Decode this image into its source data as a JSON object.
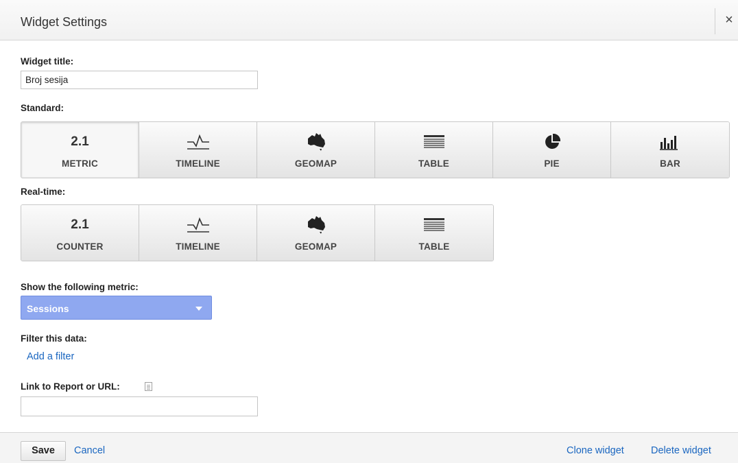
{
  "dialog": {
    "title": "Widget Settings",
    "close_symbol": "×"
  },
  "widget_title": {
    "label": "Widget title:",
    "value": "Broj sesija"
  },
  "standard": {
    "label": "Standard:",
    "options": [
      {
        "caption": "METRIC",
        "icon": "2.1",
        "icon_name": "metric-value",
        "selected": true
      },
      {
        "caption": "TIMELINE",
        "icon_name": "timeline-icon",
        "selected": false
      },
      {
        "caption": "GEOMAP",
        "icon_name": "australia-map-icon",
        "selected": false
      },
      {
        "caption": "TABLE",
        "icon_name": "table-icon",
        "selected": false
      },
      {
        "caption": "PIE",
        "icon_name": "pie-icon",
        "selected": false
      },
      {
        "caption": "BAR",
        "icon_name": "bar-chart-icon",
        "selected": false
      }
    ]
  },
  "realtime": {
    "label": "Real-time:",
    "options": [
      {
        "caption": "COUNTER",
        "icon": "2.1",
        "icon_name": "counter-value"
      },
      {
        "caption": "TIMELINE",
        "icon_name": "timeline-icon"
      },
      {
        "caption": "GEOMAP",
        "icon_name": "australia-map-icon"
      },
      {
        "caption": "TABLE",
        "icon_name": "table-icon"
      }
    ]
  },
  "metric": {
    "label": "Show the following metric:",
    "selected": "Sessions"
  },
  "filter": {
    "label": "Filter this data:",
    "add_link": "Add a filter"
  },
  "link": {
    "label": "Link to Report or URL:",
    "value": "",
    "icon_name": "document-icon"
  },
  "footer": {
    "save": "Save",
    "cancel": "Cancel",
    "clone": "Clone widget",
    "delete": "Delete widget"
  },
  "colors": {
    "select_bg": "#8fa8f0",
    "link": "#1a66c0",
    "header_bg": "#f4f4f4"
  }
}
